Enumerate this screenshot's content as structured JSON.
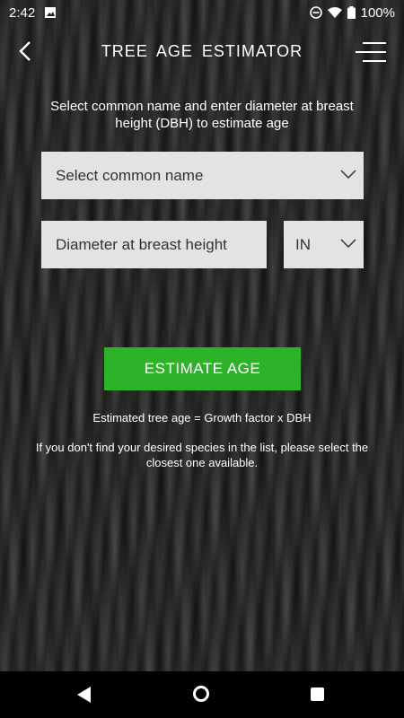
{
  "status_bar": {
    "time": "2:42",
    "battery": "100%",
    "icons": [
      "image-icon",
      "dnd-icon",
      "wifi-icon",
      "battery-icon"
    ]
  },
  "app_bar": {
    "title": "TREE  AGE  ESTIMATOR",
    "back_icon": "back-arrow-icon",
    "menu_icon": "menu-icon"
  },
  "form": {
    "instruction": "Select common name and enter diameter at breast height (DBH) to estimate age",
    "species_select": {
      "placeholder": "Select common name"
    },
    "dbh_input": {
      "placeholder": "Diameter at breast height",
      "value": ""
    },
    "unit_select": {
      "value": "IN"
    },
    "estimate_button": "ESTIMATE AGE"
  },
  "info": {
    "formula": "Estimated tree age = Growth factor x DBH",
    "note": "If you don't find your desired species in the list, please select the closest one available."
  },
  "colors": {
    "accent_green": "#2db229",
    "field_bg": "#e3e3e3",
    "nav_bg": "#000000"
  }
}
